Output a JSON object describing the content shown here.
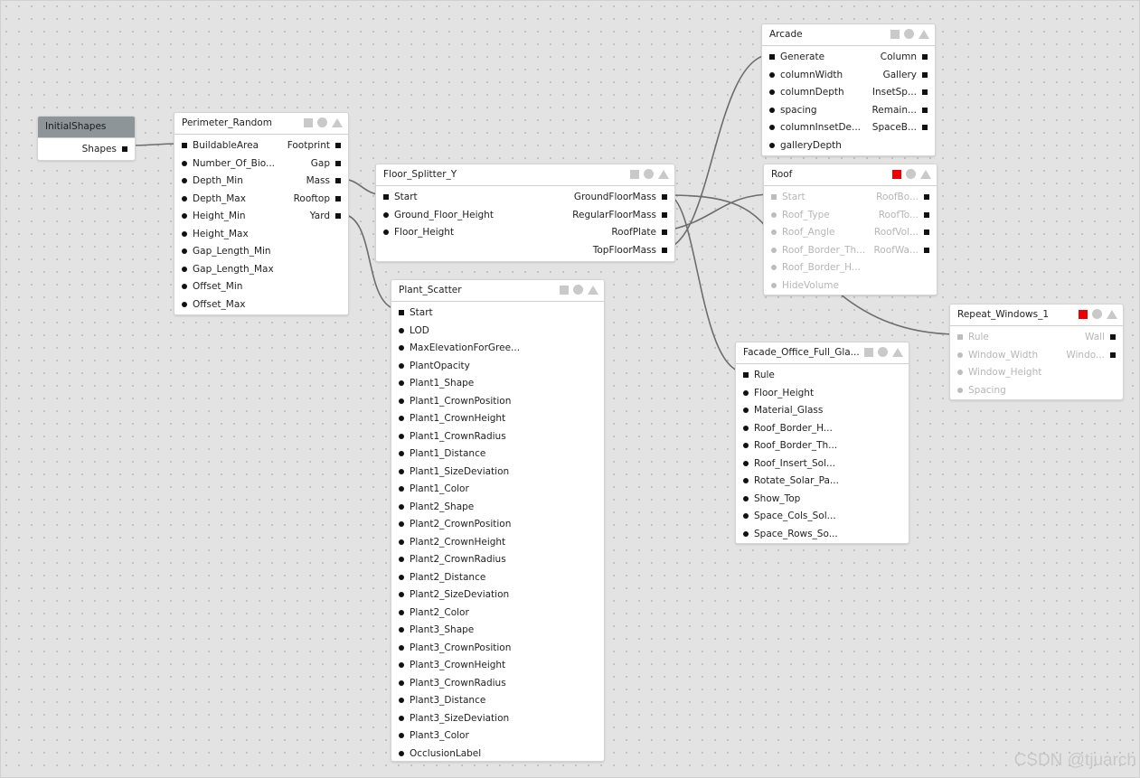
{
  "nodes": {
    "initial": {
      "title": "InitialShapes",
      "outputs": [
        "Shapes"
      ]
    },
    "perimeter": {
      "title": "Perimeter_Random",
      "inputs": [
        "BuildableArea",
        "Number_Of_Bio...",
        "Depth_Min",
        "Depth_Max",
        "Height_Min",
        "Height_Max",
        "Gap_Length_Min",
        "Gap_Length_Max",
        "Offset_Min",
        "Offset_Max"
      ],
      "outputs": [
        "Footprint",
        "Gap",
        "Mass",
        "Rooftop",
        "Yard"
      ]
    },
    "floor": {
      "title": "Floor_Splitter_Y",
      "inputs": [
        "Start",
        "Ground_Floor_Height",
        "Floor_Height"
      ],
      "outputs": [
        "GroundFloorMass",
        "RegularFloorMass",
        "RoofPlate",
        "TopFloorMass"
      ]
    },
    "plant": {
      "title": "Plant_Scatter",
      "inputs": [
        "Start",
        "LOD",
        "MaxElevationForGree...",
        "PlantOpacity",
        "Plant1_Shape",
        "Plant1_CrownPosition",
        "Plant1_CrownHeight",
        "Plant1_CrownRadius",
        "Plant1_Distance",
        "Plant1_SizeDeviation",
        "Plant1_Color",
        "Plant2_Shape",
        "Plant2_CrownPosition",
        "Plant2_CrownHeight",
        "Plant2_CrownRadius",
        "Plant2_Distance",
        "Plant2_SizeDeviation",
        "Plant2_Color",
        "Plant3_Shape",
        "Plant3_CrownPosition",
        "Plant3_CrownHeight",
        "Plant3_CrownRadius",
        "Plant3_Distance",
        "Plant3_SizeDeviation",
        "Plant3_Color",
        "OcclusionLabel"
      ]
    },
    "arcade": {
      "title": "Arcade",
      "inputs": [
        "Generate",
        "columnWidth",
        "columnDepth",
        "spacing",
        "columnInsetDe...",
        "galleryDepth"
      ],
      "outputs": [
        "Column",
        "Gallery",
        "InsetSp...",
        "Remain...",
        "SpaceB..."
      ]
    },
    "roof": {
      "title": "Roof",
      "inputs": [
        "Start",
        "Roof_Type",
        "Roof_Angle",
        "Roof_Border_Th...",
        "Roof_Border_H...",
        "HideVolume"
      ],
      "outputs": [
        "RoofBo...",
        "RoofTo...",
        "RoofVol...",
        "RoofWa..."
      ]
    },
    "facade": {
      "title": "Facade_Office_Full_Gla...",
      "inputs": [
        "Rule",
        "Floor_Height",
        "Material_Glass",
        "Roof_Border_H...",
        "Roof_Border_Th...",
        "Roof_Insert_Sol...",
        "Rotate_Solar_Pa...",
        "Show_Top",
        "Space_Cols_Sol...",
        "Space_Rows_So..."
      ]
    },
    "repeat": {
      "title": "Repeat_Windows_1",
      "inputs": [
        "Rule",
        "Window_Width",
        "Window_Height",
        "Spacing"
      ],
      "outputs": [
        "Wall",
        "Windo..."
      ]
    }
  },
  "colors": {
    "canvas": "#e3e3e3",
    "header_gray": "#8d9599",
    "active_red": "#ee0000",
    "wire": "#6d6d6d"
  },
  "icons": [
    "square-icon",
    "circle-icon",
    "triangle-icon"
  ],
  "watermark": "CSDN @tjuarch"
}
